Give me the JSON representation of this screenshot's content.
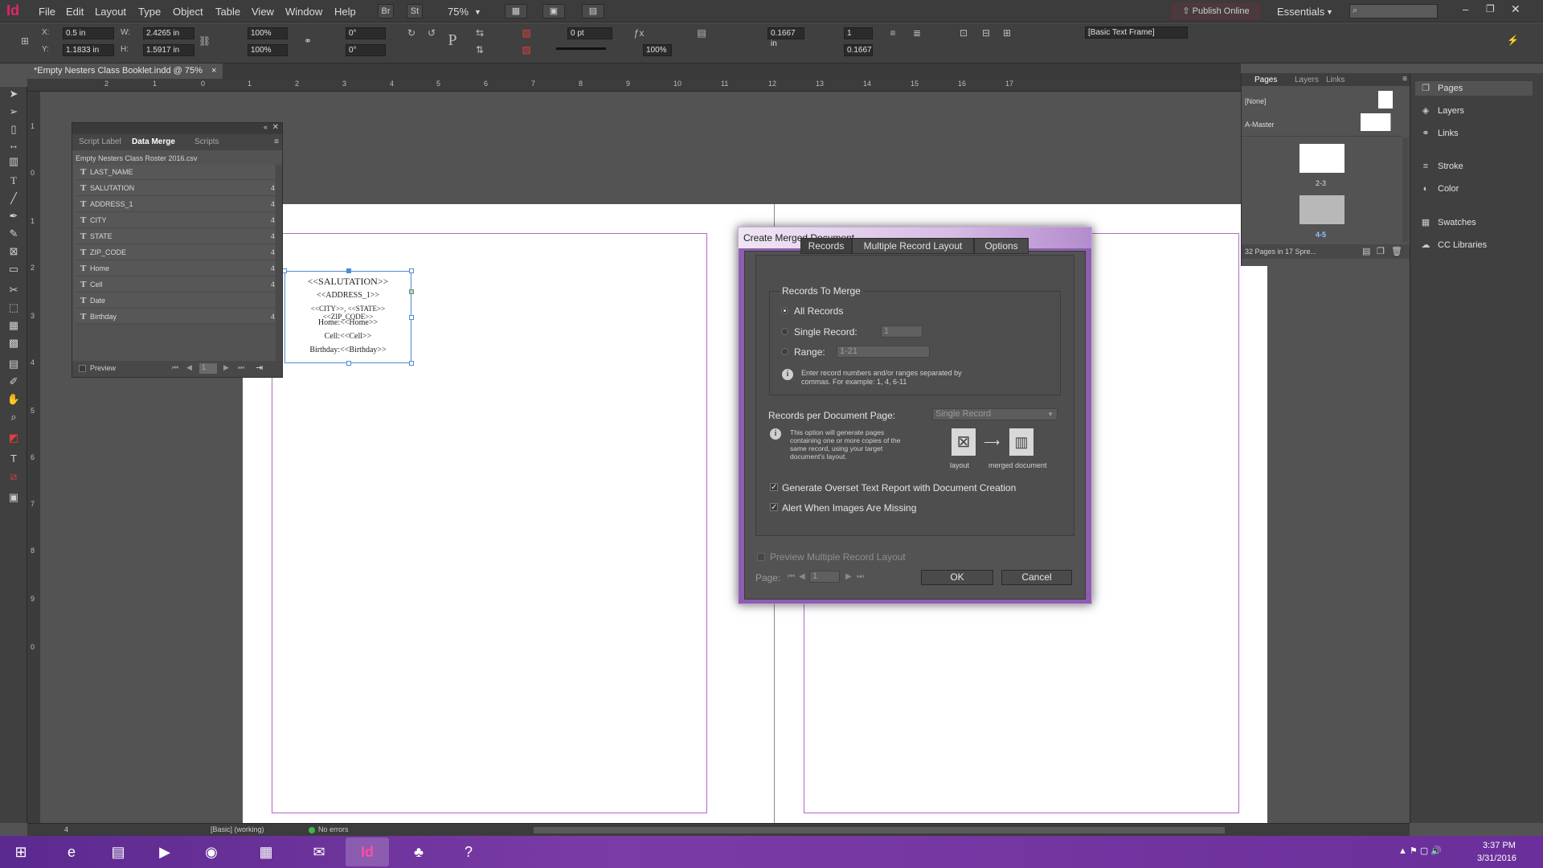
{
  "app": {
    "logo": "Id"
  },
  "menu": [
    "File",
    "Edit",
    "Layout",
    "Type",
    "Object",
    "Table",
    "View",
    "Window",
    "Help"
  ],
  "topbar": {
    "br": "Br",
    "st": "St",
    "zoom": "75%",
    "publish": "Publish Online",
    "workspace": "Essentials",
    "search_placeholder": ""
  },
  "control": {
    "x_label": "X:",
    "x": "0.5 in",
    "y_label": "Y:",
    "y": "1.1833 in",
    "w_label": "W:",
    "w": "2.4265 in",
    "h_label": "H:",
    "h": "1.5917 in",
    "scale_x": "100%",
    "scale_y": "100%",
    "rotate": "0°",
    "shear": "0°",
    "stroke": "0 pt",
    "opacity": "100%",
    "inset": "0.1667 in",
    "columns": "1",
    "gutter": "0.1667",
    "style": "[Basic Text Frame]"
  },
  "document": {
    "tab": "*Empty Nesters Class Booklet.indd @ 75%",
    "tab_close": "×"
  },
  "ruler_top": [
    "2",
    "1",
    "0",
    "1",
    "2",
    "3",
    "4",
    "5",
    "6",
    "7",
    "8",
    "9",
    "10",
    "11",
    "12",
    "13",
    "14",
    "15",
    "16",
    "17"
  ],
  "ruler_left": [
    "1",
    "0",
    "1",
    "2",
    "3",
    "4",
    "5",
    "6",
    "7",
    "8",
    "9",
    "0"
  ],
  "data_merge": {
    "tabs": [
      "Script Label",
      "Data Merge",
      "Scripts"
    ],
    "source": "Empty Nesters Class Roster 2016.csv",
    "fields": [
      {
        "name": "LAST_NAME",
        "count": ""
      },
      {
        "name": "SALUTATION",
        "count": "4"
      },
      {
        "name": "ADDRESS_1",
        "count": "4"
      },
      {
        "name": "CITY",
        "count": "4"
      },
      {
        "name": "STATE",
        "count": "4"
      },
      {
        "name": "ZIP_CODE",
        "count": "4"
      },
      {
        "name": "Home",
        "count": "4"
      },
      {
        "name": "Cell",
        "count": "4"
      },
      {
        "name": "Date",
        "count": ""
      },
      {
        "name": "Birthday",
        "count": "4"
      }
    ],
    "preview": "Preview",
    "record": "1"
  },
  "frame": {
    "lines": [
      "<<SALUTATION>>",
      "<<ADDRESS_1>>",
      "<<CITY>>, <<STATE>> <<ZIP_CODE>>",
      "Home:<<Home>>",
      "Cell:<<Cell>>",
      "Birthday:<<Birthday>>"
    ]
  },
  "dialog": {
    "title": "Create Merged Document",
    "tabs": [
      "Records",
      "Multiple Record Layout",
      "Options"
    ],
    "records_group": "Records To Merge",
    "all_records": "All Records",
    "single_record": "Single Record:",
    "single_value": "1",
    "range": "Range:",
    "range_value": "1-21",
    "range_hint": "Enter record numbers and/or ranges separated by commas. For example: 1, 4, 6-11",
    "per_page_label": "Records per Document Page:",
    "per_page_value": "Single Record",
    "per_page_hint": "This option will generate pages containing one or more copies of the same record, using your target document's layout.",
    "layout_caption": "layout",
    "merged_caption": "merged document",
    "overset": "Generate Overset Text Report with Document Creation",
    "images_missing": "Alert When Images Are Missing",
    "preview_multi": "Preview Multiple Record Layout",
    "page_label": "Page:",
    "page_value": "1",
    "ok": "OK",
    "cancel": "Cancel"
  },
  "pages_panel": {
    "tabs": [
      "Pages",
      "Layers",
      "Links"
    ],
    "none": "[None]",
    "master": "A-Master",
    "spread1": "2-3",
    "spread2": "4-5",
    "summary": "32 Pages in 17 Spre..."
  },
  "dock": [
    "Pages",
    "Layers",
    "Links",
    "Stroke",
    "Color",
    "Swatches",
    "CC Libraries"
  ],
  "status": {
    "page": "4",
    "style": "[Basic] (working)",
    "errors": "No errors"
  },
  "clock": {
    "time": "3:37 PM",
    "date": "3/31/2016"
  }
}
